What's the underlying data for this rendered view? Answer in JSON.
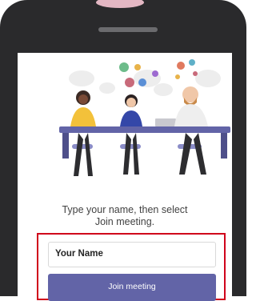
{
  "screen": {
    "illustration_icon": "team-meeting-illustration",
    "prompt_line1": "Type your name, then select",
    "prompt_line2": "Join meeting.",
    "name_field": {
      "value": "Your Name"
    },
    "join_button": {
      "label": "Join meeting"
    }
  },
  "colors": {
    "phone_frame": "#2a2a2c",
    "accent_purple": "#6264a7",
    "highlight_red": "#d0021b"
  }
}
